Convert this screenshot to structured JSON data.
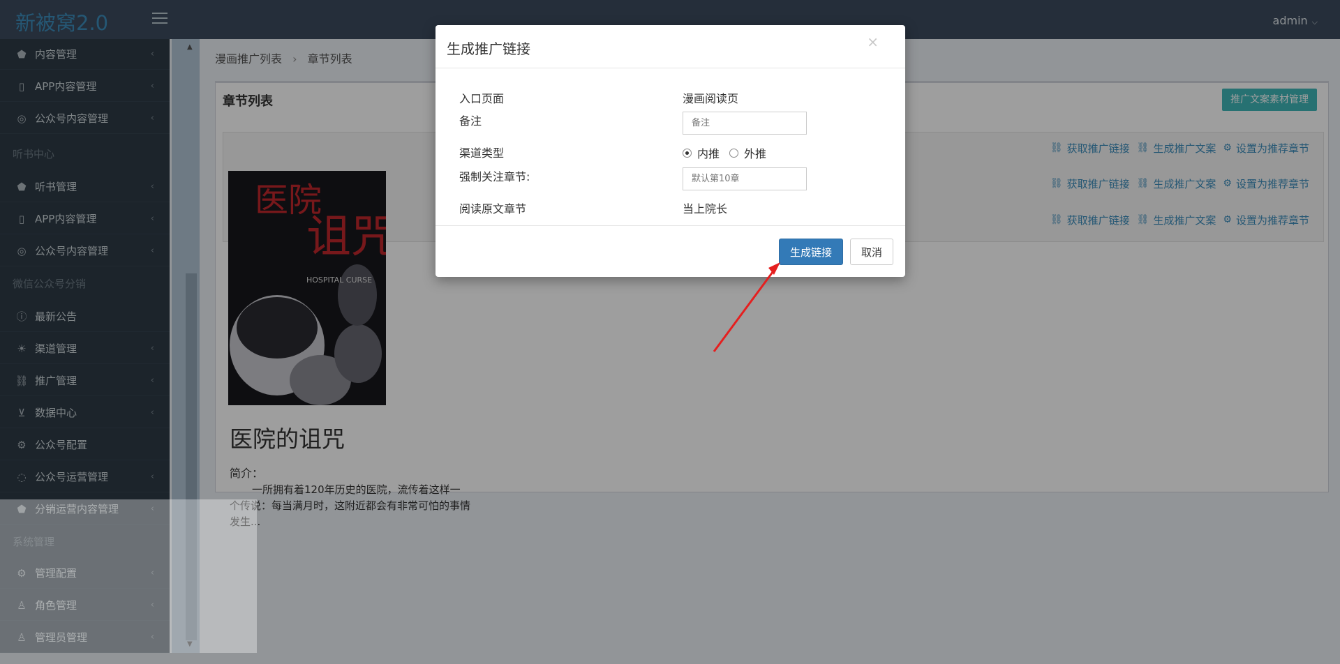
{
  "app": {
    "brand": "新被窝2.0",
    "user": "admin"
  },
  "sidebar": {
    "items": [
      {
        "label": "内容管理",
        "icon": "tag-icon"
      },
      {
        "label": "APP内容管理",
        "icon": "mobile-icon"
      },
      {
        "label": "公众号内容管理",
        "icon": "compass-icon"
      },
      {
        "label": "听书中心",
        "type": "header"
      },
      {
        "label": "听书管理",
        "icon": "tag-icon"
      },
      {
        "label": "APP内容管理",
        "icon": "mobile-icon"
      },
      {
        "label": "公众号内容管理",
        "icon": "compass-icon"
      },
      {
        "label": "微信公众号分销",
        "type": "header"
      },
      {
        "label": "最新公告",
        "icon": "info-icon"
      },
      {
        "label": "渠道管理",
        "icon": "lightbulb-icon"
      },
      {
        "label": "推广管理",
        "icon": "link-icon"
      },
      {
        "label": "数据中心",
        "icon": "cart-icon"
      },
      {
        "label": "公众号配置",
        "icon": "gear-icon"
      },
      {
        "label": "公众号运营管理",
        "icon": "comments-icon"
      },
      {
        "label": "分销运营内容管理",
        "icon": "tag-icon"
      },
      {
        "label": "系统管理",
        "type": "header"
      },
      {
        "label": "管理配置",
        "icon": "gear-icon"
      },
      {
        "label": "角色管理",
        "icon": "user-icon"
      },
      {
        "label": "管理员管理",
        "icon": "user-icon"
      }
    ]
  },
  "breadcrumb": {
    "first": "漫画推广列表",
    "second": "章节列表"
  },
  "box": {
    "title": "章节列表",
    "material_button": "推广文案素材管理",
    "actions": {
      "get_link": "获取推广链接",
      "gen_copy": "生成推广文案",
      "set_recommend": "设置为推荐章节"
    }
  },
  "book": {
    "cover_title_line1": "医院",
    "cover_title_line2": "诅咒",
    "cover_sub": "HOSPITAL CURSE",
    "title": "医院的诅咒",
    "intro_label": "简介：",
    "intro": "一所拥有着120年历史的医院，流传着这样一个传说：每当满月时，这附近都会有非常可怕的事情发生..."
  },
  "modal": {
    "title": "生成推广链接",
    "close": "×",
    "entry_label": "入口页面",
    "entry_value": "漫画阅读页",
    "note_label": "备注",
    "note_placeholder": "备注",
    "channel_label": "渠道类型",
    "channel_options": {
      "inner": "内推",
      "outer": "外推"
    },
    "force_label": "强制关注章节:",
    "force_placeholder": "默认第10章",
    "read_label": "阅读原文章节",
    "read_value": "当上院长",
    "submit": "生成链接",
    "cancel": "取消"
  }
}
